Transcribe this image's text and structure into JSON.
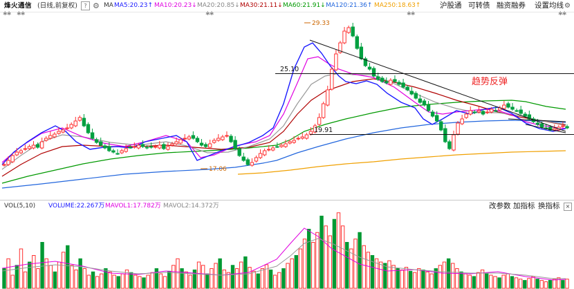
{
  "header": {
    "stock_name": "烽火通信",
    "period_label": "(日线,前复权)",
    "help_label": "?",
    "ma_label": "MA",
    "ma_items": [
      {
        "label": "MA5:20.23",
        "arrow": "↑",
        "color": "#1a1aff"
      },
      {
        "label": "MA10:20.23",
        "arrow": "↓",
        "color": "#e000e0"
      },
      {
        "label": "MA20:20.85",
        "arrow": "↓",
        "color": "#888888"
      },
      {
        "label": "MA30:21.11",
        "arrow": "↓",
        "color": "#b00000"
      },
      {
        "label": "MA60:21.91",
        "arrow": "↓",
        "color": "#009900"
      },
      {
        "label": "MA120:21.36",
        "arrow": "↑",
        "color": "#2266dd"
      },
      {
        "label": "MA250:18.63",
        "arrow": "↑",
        "color": "#f0a000"
      }
    ],
    "links": [
      "沪股通",
      "可转债",
      "融资融券",
      "设置均线"
    ],
    "stars": "✱✱"
  },
  "chart": {
    "annotations": {
      "high": "29.33",
      "low": "17.06",
      "level_upper": "25.10",
      "level_lower": "19.91",
      "trend_text": "趋势反弹"
    }
  },
  "volume": {
    "label": "VOL(5,10)",
    "volume_value": "VOLUME:22.267万",
    "mavol1": "MAVOL1:17.782万",
    "mavol2": "MAVOL2:14.372万",
    "buttons": [
      "改参数",
      "加指标",
      "换指标"
    ],
    "close_label": "×",
    "colors": {
      "up": "#ff3030",
      "down": "#009933",
      "mavol1": "#e000e0",
      "mavol2": "#888888"
    }
  }
}
